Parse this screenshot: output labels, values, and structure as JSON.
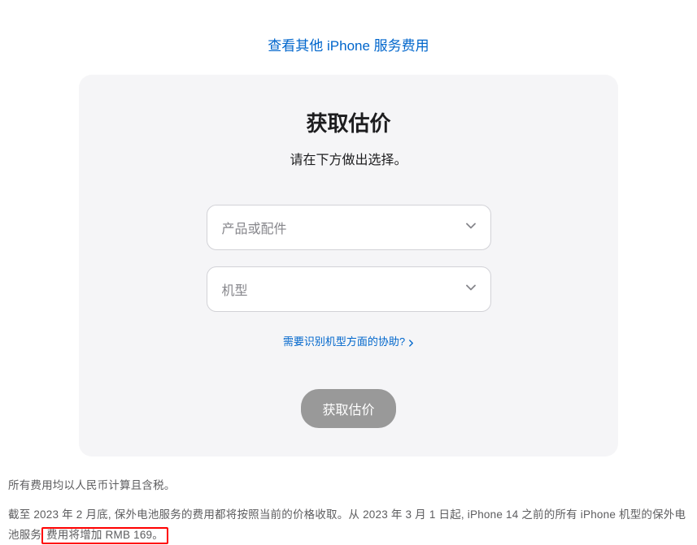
{
  "topLink": {
    "text": "查看其他 iPhone 服务费用"
  },
  "card": {
    "title": "获取估价",
    "subtitle": "请在下方做出选择。",
    "select1": {
      "placeholder": "产品或配件"
    },
    "select2": {
      "placeholder": "机型"
    },
    "helpLink": "需要识别机型方面的协助?",
    "submitButton": "获取估价"
  },
  "footer": {
    "line1": "所有费用均以人民币计算且含税。",
    "line2_part1": "截至 2023 年 2 月底, 保外电池服务的费用都将按照当前的价格收取。从 2023 年 3 月 1 日起, iPhone 14 之前的所有 iPhone 机型的保外电池服务",
    "line2_highlight": "费用将增加 RMB 169。"
  }
}
